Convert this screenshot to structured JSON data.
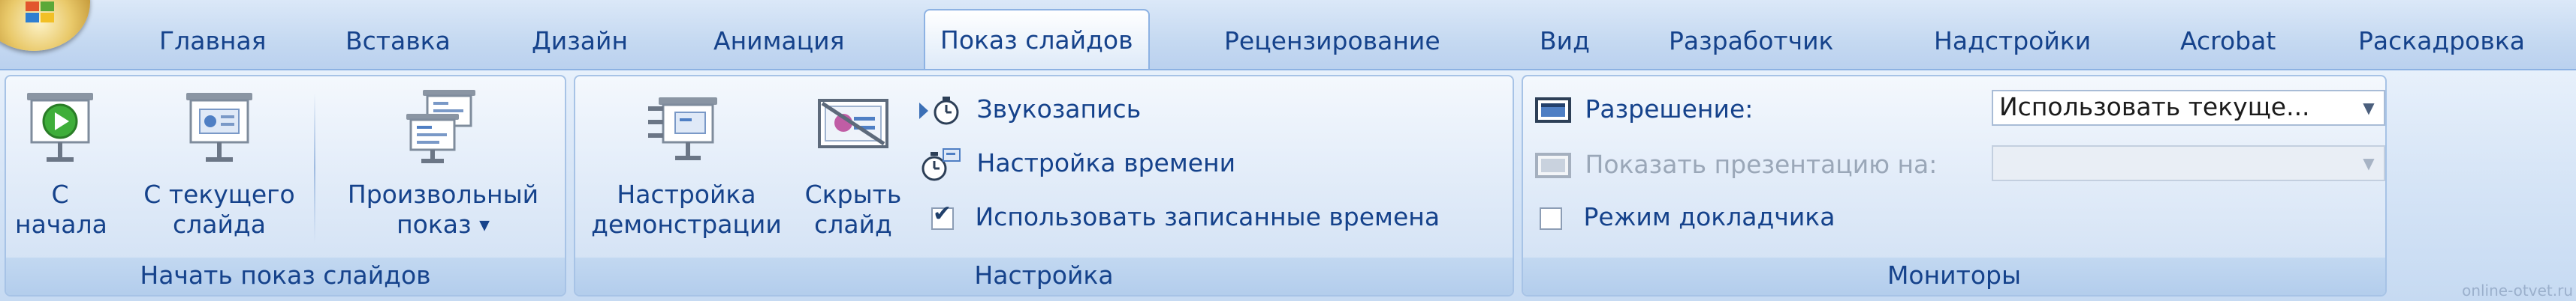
{
  "tabs": [
    {
      "label": "Главная",
      "active": false
    },
    {
      "label": "Вставка",
      "active": false
    },
    {
      "label": "Дизайн",
      "active": false
    },
    {
      "label": "Анимация",
      "active": false
    },
    {
      "label": "Показ слайдов",
      "active": true
    },
    {
      "label": "Рецензирование",
      "active": false
    },
    {
      "label": "Вид",
      "active": false
    },
    {
      "label": "Разработчик",
      "active": false
    },
    {
      "label": "Надстройки",
      "active": false
    },
    {
      "label": "Acrobat",
      "active": false
    },
    {
      "label": "Раскадровка",
      "active": false
    }
  ],
  "groups": {
    "start": {
      "label": "Начать показ слайдов",
      "from_beginning": {
        "line1": "С",
        "line2": "начала"
      },
      "from_current": {
        "line1": "С текущего",
        "line2": "слайда"
      },
      "custom": {
        "line1": "Произвольный",
        "line2": "показ",
        "dropdown_icon": "dropdown-arrow"
      }
    },
    "setup": {
      "label": "Настройка",
      "setup_show": {
        "line1": "Настройка",
        "line2": "демонстрации"
      },
      "hide_slide": {
        "line1": "Скрыть",
        "line2": "слайд"
      },
      "record_narration": "Звукозапись",
      "rehearse_timings": "Настройка времени",
      "use_timings": {
        "label": "Использовать записанные времена",
        "checked": true
      }
    },
    "monitors": {
      "label": "Мониторы",
      "resolution": {
        "label": "Разрешение:",
        "value": "Использовать текуще..."
      },
      "show_on": {
        "label": "Показать презентацию на:",
        "value": "",
        "disabled": true
      },
      "presenter_view": {
        "label": "Режим докладчика",
        "checked": false
      }
    }
  },
  "watermark": "online-otvet.ru",
  "colors": {
    "accent": "#15428b",
    "ribbon_border": "#8db2e3",
    "play_green": "#3fae3a"
  }
}
